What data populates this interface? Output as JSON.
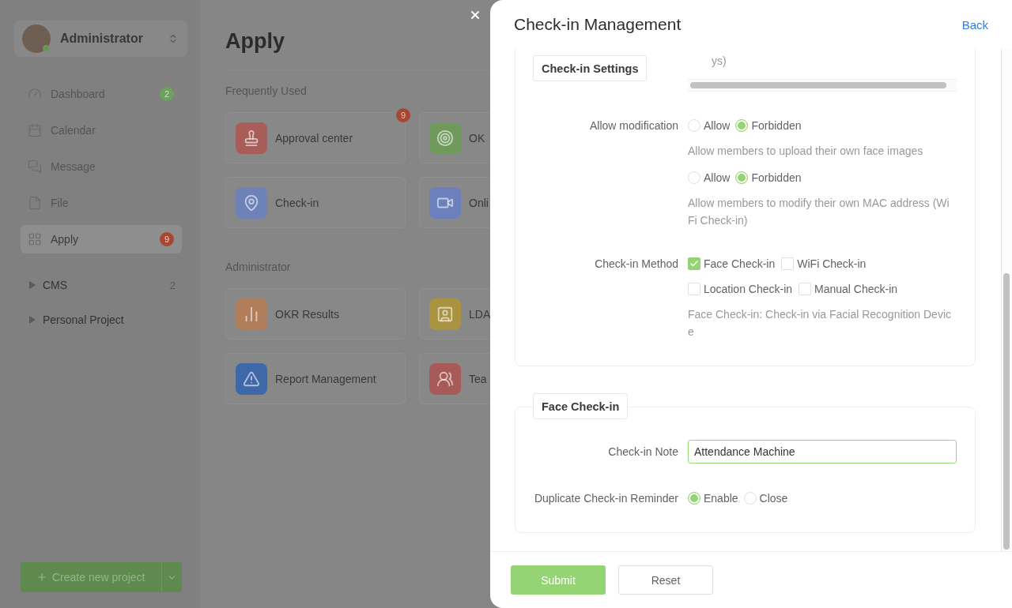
{
  "sidebar": {
    "profile": {
      "name": "Administrator",
      "online": true
    },
    "nav_items": [
      {
        "label": "Dashboard",
        "selected": false,
        "badge": {
          "text": "2",
          "color": "#6ca35c"
        }
      },
      {
        "label": "Calendar",
        "selected": false
      },
      {
        "label": "Message",
        "selected": false
      },
      {
        "label": "File",
        "selected": false
      },
      {
        "label": "Apply",
        "selected": true,
        "badge": {
          "text": "9",
          "color": "#a8472f"
        }
      }
    ],
    "groups": [
      {
        "label": "CMS",
        "expanded": false,
        "count": "2"
      },
      {
        "label": "Personal Project",
        "expanded": false
      }
    ],
    "create_button": {
      "label": "Create new project"
    }
  },
  "main": {
    "title": "Apply",
    "sections": [
      {
        "heading": "Frequently Used",
        "apps": [
          {
            "name": "Approval center",
            "color": "#a85d58",
            "badge": "9"
          },
          {
            "name": "OK",
            "color": "#6f9a5c"
          },
          {
            "name": "Check-in",
            "color": "#6d82b8"
          },
          {
            "name": "Onli",
            "color": "#6b80bc"
          }
        ]
      },
      {
        "heading": "Administrator",
        "apps": [
          {
            "name": "OKR Results",
            "color": "#b07e5a"
          },
          {
            "name": "LDA",
            "color": "#aa9340"
          },
          {
            "name": "Report Management",
            "color": "#3f68a8"
          },
          {
            "name": "Tea",
            "color": "#a85a58"
          }
        ]
      }
    ]
  },
  "drawer": {
    "title": "Check-in Management",
    "back_link": "Back",
    "sections": [
      {
        "legend": "Check-in Settings",
        "partial_hint": "ys)",
        "rows": [
          {
            "kind": "radios",
            "label": "Allow modification",
            "groups": [
              {
                "options": [
                  {
                    "label": "Allow",
                    "selected": false
                  },
                  {
                    "label": "Forbidden",
                    "selected": true
                  }
                ],
                "hint": "Allow members to upload their own face images"
              },
              {
                "options": [
                  {
                    "label": "Allow",
                    "selected": false
                  },
                  {
                    "label": "Forbidden",
                    "selected": true
                  }
                ],
                "hint": "Allow members to modify their own MAC address (WiFi Check-in)"
              }
            ]
          },
          {
            "kind": "checkboxes",
            "label": "Check-in Method",
            "options": [
              {
                "label": "Face Check-in",
                "checked": true
              },
              {
                "label": "WiFi Check-in",
                "checked": false
              },
              {
                "label": "Location Check-in",
                "checked": false
              },
              {
                "label": "Manual Check-in",
                "checked": false
              }
            ],
            "hint": "Face Check-in: Check-in via Facial Recognition Device"
          }
        ]
      },
      {
        "legend": "Face Check-in",
        "rows": [
          {
            "kind": "input",
            "label": "Check-in Note",
            "value": "Attendance Machine",
            "focused": true
          },
          {
            "kind": "radios",
            "label": "Duplicate Check-in Reminder",
            "groups": [
              {
                "options": [
                  {
                    "label": "Enable",
                    "selected": true
                  },
                  {
                    "label": "Close",
                    "selected": false
                  }
                ]
              }
            ]
          }
        ]
      }
    ],
    "footer": {
      "buttons": [
        {
          "label": "Submit",
          "kind": "primary"
        },
        {
          "label": "Reset",
          "kind": "default"
        }
      ]
    }
  }
}
